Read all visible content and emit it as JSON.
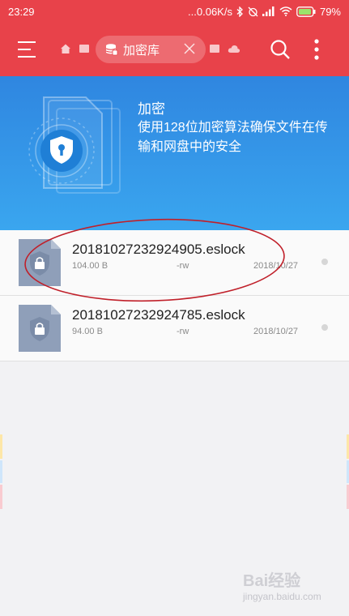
{
  "status_bar": {
    "time": "23:29",
    "network_speed": "...0.06K/s",
    "battery": "79%"
  },
  "app_bar": {
    "current_location": "加密库"
  },
  "banner": {
    "title": "加密",
    "description": "使用128位加密算法确保文件在传输和网盘中的安全"
  },
  "files": [
    {
      "name": "20181027232924905.eslock",
      "size": "104.00 B",
      "permissions": "-rw",
      "date": "2018/10/27"
    },
    {
      "name": "20181027232924785.eslock",
      "size": "94.00 B",
      "permissions": "-rw",
      "date": "2018/10/27"
    }
  ],
  "watermark": {
    "brand": "Bai",
    "brand_suffix": "经验",
    "url": "jingyan.baidu.com"
  },
  "colors": {
    "app_bar": "#e8424a",
    "banner_top": "#2f86e0",
    "banner_bottom": "#3aa6ef",
    "annotation": "#c0202a",
    "file_icon": "#8f9fb9"
  }
}
